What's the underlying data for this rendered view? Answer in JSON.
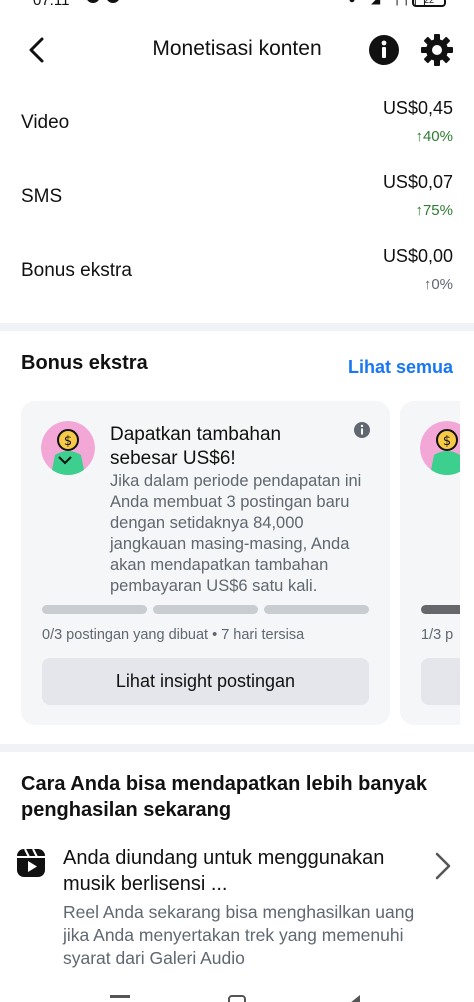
{
  "status_bar": {
    "time": "07.11",
    "battery": "22"
  },
  "header": {
    "title": "Monetisasi konten"
  },
  "earnings": [
    {
      "label": "Video",
      "value": "US$0,45",
      "change": "↑40%"
    },
    {
      "label": "SMS",
      "value": "US$0,07",
      "change": "↑75%"
    },
    {
      "label": "Bonus ekstra",
      "value": "US$0,00",
      "change": "↑0%"
    }
  ],
  "bonus_section": {
    "title": "Bonus ekstra",
    "see_all": "Lihat semua",
    "card": {
      "title": "Dapatkan tambahan sebesar US$6!",
      "body": "Jika dalam periode pendapatan ini Anda membuat 3 postingan baru dengan setidaknya 84,000 jangkauan masing-masing, Anda akan mendapatkan tambahan pembayaran US$6 satu kali.",
      "progress_done": 0,
      "progress_total": 3,
      "progress_text": "0/3 postingan yang dibuat • 7 hari tersisa",
      "button": "Lihat insight postingan"
    },
    "card2_progress_text": "1/3 p"
  },
  "more_section": {
    "title": "Cara Anda bisa mendapatkan lebih banyak penghasilan sekarang",
    "item": {
      "title": "Anda diundang untuk menggunakan musik berlisensi ...",
      "description": "Reel Anda sekarang bisa menghasilkan uang jika Anda menyertakan trek yang memenuhi syarat dari Galeri Audio"
    }
  },
  "colors": {
    "accent": "#1877f2",
    "positive": "#2e7d32",
    "card_bg": "#f5f6f7",
    "progress": "#c9ccd1"
  }
}
